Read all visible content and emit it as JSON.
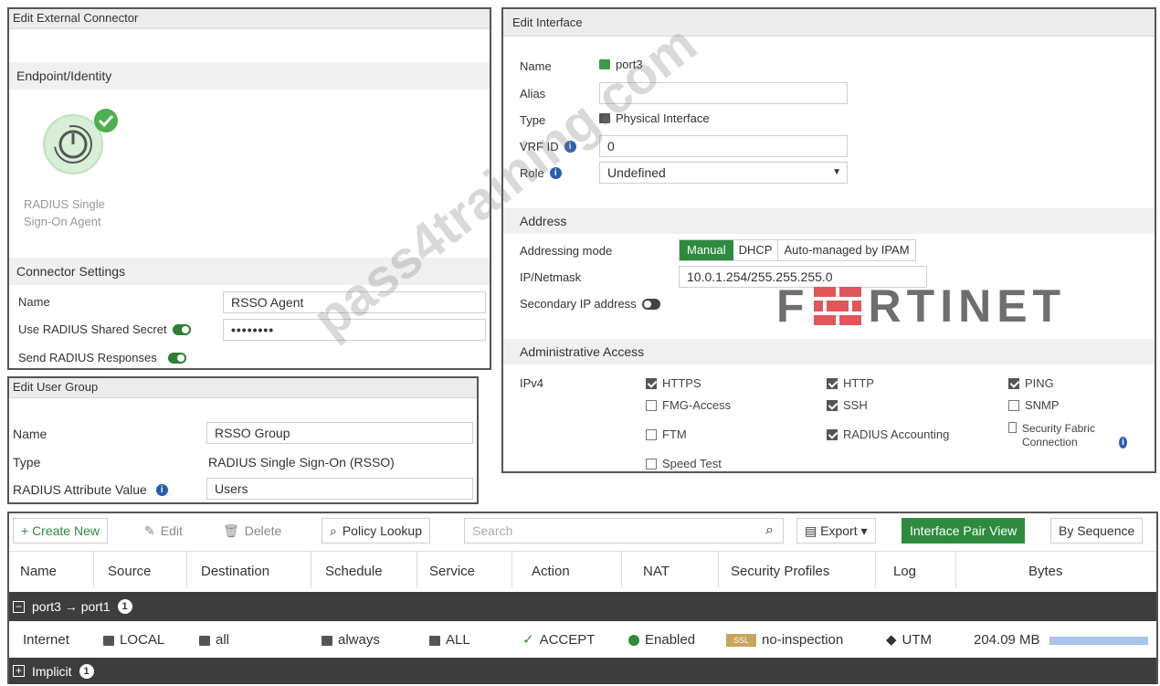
{
  "external_connector": {
    "title": "Edit External Connector",
    "section_endpoint": "Endpoint/Identity",
    "connector_label": "RADIUS Single Sign-On Agent",
    "section_settings": "Connector Settings",
    "name_label": "Name",
    "name_value": "RSSO Agent",
    "secret_label": "Use RADIUS Shared Secret",
    "secret_value": "••••••••",
    "responses_label": "Send RADIUS Responses"
  },
  "user_group": {
    "title": "Edit User Group",
    "name_label": "Name",
    "name_value": "RSSO Group",
    "type_label": "Type",
    "type_value": "RADIUS Single Sign-On (RSSO)",
    "attr_label": "RADIUS Attribute Value",
    "attr_value": "Users"
  },
  "interface": {
    "title": "Edit Interface",
    "name_label": "Name",
    "name_value": "port3",
    "alias_label": "Alias",
    "alias_value": "",
    "type_label": "Type",
    "type_value": "Physical Interface",
    "vrf_label": "VRF ID",
    "vrf_value": "0",
    "role_label": "Role",
    "role_value": "Undefined",
    "section_address": "Address",
    "addressing_label": "Addressing mode",
    "mode_manual": "Manual",
    "mode_dhcp": "DHCP",
    "mode_ipam": "Auto-managed by IPAM",
    "ip_label": "IP/Netmask",
    "ip_value": "10.0.1.254/255.255.255.0",
    "secondary_label": "Secondary IP address",
    "section_admin": "Administrative Access",
    "ipv4_label": "IPv4",
    "access": [
      {
        "label": "HTTPS",
        "checked": true
      },
      {
        "label": "HTTP",
        "checked": true
      },
      {
        "label": "PING",
        "checked": true
      },
      {
        "label": "FMG-Access",
        "checked": false
      },
      {
        "label": "SSH",
        "checked": true
      },
      {
        "label": "SNMP",
        "checked": false
      },
      {
        "label": "FTM",
        "checked": false
      },
      {
        "label": "RADIUS Accounting",
        "checked": true
      },
      {
        "label": "Security Fabric Connection",
        "checked": false
      },
      {
        "label": "Speed Test",
        "checked": false
      }
    ]
  },
  "brand": {
    "logo_text": "FÉRTINET",
    "watermark": "pass4training.com"
  },
  "policy": {
    "toolbar": {
      "create": "+ Create New",
      "edit": "Edit",
      "delete": "Delete",
      "lookup": "Policy Lookup",
      "search_placeholder": "Search",
      "export": "Export",
      "pair_view": "Interface Pair View",
      "by_sequence": "By Sequence"
    },
    "columns": [
      "Name",
      "Source",
      "Destination",
      "Schedule",
      "Service",
      "Action",
      "NAT",
      "Security Profiles",
      "Log",
      "Bytes"
    ],
    "group1": {
      "label": "port3 → port1",
      "count": "1"
    },
    "row": {
      "name": "Internet",
      "source": "LOCAL",
      "destination": "all",
      "schedule": "always",
      "service": "ALL",
      "action": "ACCEPT",
      "nat": "Enabled",
      "ssl_badge": "SSL",
      "profile": "no-inspection",
      "log": "UTM",
      "bytes": "204.09 MB"
    },
    "group2": {
      "label": "Implicit",
      "count": "1"
    }
  },
  "colors": {
    "accent_green": "#2e8b3e",
    "group_bar": "#3d3d3d",
    "bytes_bar": "#a9c4ec"
  }
}
